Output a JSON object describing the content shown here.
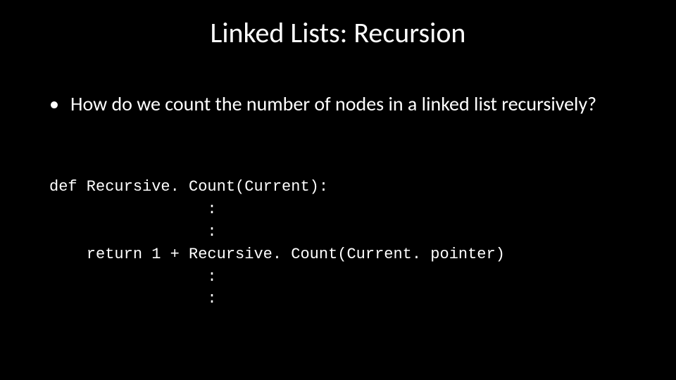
{
  "title": "Linked Lists: Recursion",
  "bullet": {
    "dot": "•",
    "text": "How do we count the number of nodes in a linked list recursively?"
  },
  "code": {
    "l1": "def Recursive. Count(Current):",
    "l2": "                 :",
    "l3": "                 :",
    "l4": "    return 1 + Recursive. Count(Current. pointer)",
    "l5": "                 :",
    "l6": "                 :"
  }
}
